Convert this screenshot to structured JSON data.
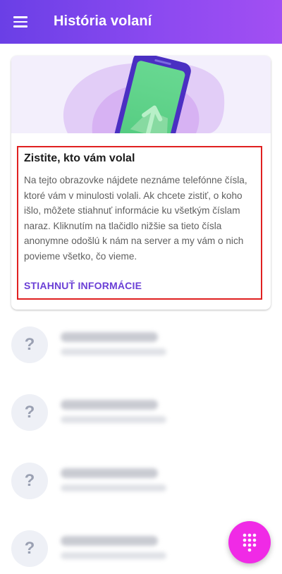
{
  "appbar": {
    "title": "História volaní",
    "menu_icon": "hamburger-menu-icon"
  },
  "card": {
    "hero_icon": "phone-upload-illustration",
    "title": "Zistite, kto vám volal",
    "body": "Na tejto obrazovke nájdete neznáme telefónne čísla, ktoré vám v minulosti volali. Ak chcete zistiť, o koho išlo, môžete stiahnuť informácie ku všetkým číslam naraz. Kliknutím na tlačidlo nižšie sa tieto čísla anonymne odošlú k nám na server a my vám o nich povieme všetko, čo vieme.",
    "action_label": "STIAHNUŤ INFORMÁCIE"
  },
  "calls": [
    {
      "avatar": "?"
    },
    {
      "avatar": "?"
    },
    {
      "avatar": "?"
    },
    {
      "avatar": "?"
    }
  ],
  "fab": {
    "icon": "dialpad-icon"
  },
  "colors": {
    "appbar_start": "#6a3fe6",
    "appbar_end": "#a24ff3",
    "accent": "#6a3fd6",
    "fab": "#f02ae6",
    "highlight_border": "#e02020"
  }
}
